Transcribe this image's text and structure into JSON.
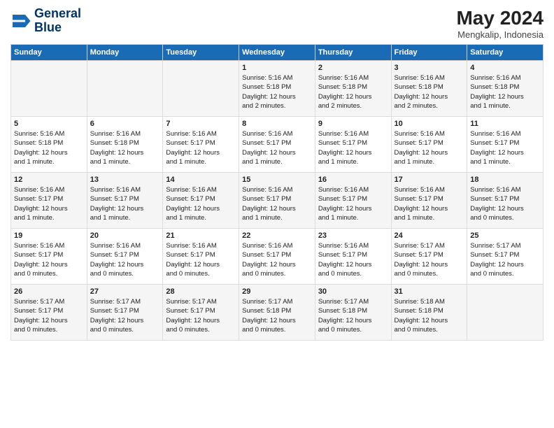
{
  "header": {
    "logo_line1": "General",
    "logo_line2": "Blue",
    "month_year": "May 2024",
    "location": "Mengkalip, Indonesia"
  },
  "weekdays": [
    "Sunday",
    "Monday",
    "Tuesday",
    "Wednesday",
    "Thursday",
    "Friday",
    "Saturday"
  ],
  "weeks": [
    [
      {
        "day": "",
        "detail": ""
      },
      {
        "day": "",
        "detail": ""
      },
      {
        "day": "",
        "detail": ""
      },
      {
        "day": "1",
        "detail": "Sunrise: 5:16 AM\nSunset: 5:18 PM\nDaylight: 12 hours\nand 2 minutes."
      },
      {
        "day": "2",
        "detail": "Sunrise: 5:16 AM\nSunset: 5:18 PM\nDaylight: 12 hours\nand 2 minutes."
      },
      {
        "day": "3",
        "detail": "Sunrise: 5:16 AM\nSunset: 5:18 PM\nDaylight: 12 hours\nand 2 minutes."
      },
      {
        "day": "4",
        "detail": "Sunrise: 5:16 AM\nSunset: 5:18 PM\nDaylight: 12 hours\nand 1 minute."
      }
    ],
    [
      {
        "day": "5",
        "detail": "Sunrise: 5:16 AM\nSunset: 5:18 PM\nDaylight: 12 hours\nand 1 minute."
      },
      {
        "day": "6",
        "detail": "Sunrise: 5:16 AM\nSunset: 5:18 PM\nDaylight: 12 hours\nand 1 minute."
      },
      {
        "day": "7",
        "detail": "Sunrise: 5:16 AM\nSunset: 5:17 PM\nDaylight: 12 hours\nand 1 minute."
      },
      {
        "day": "8",
        "detail": "Sunrise: 5:16 AM\nSunset: 5:17 PM\nDaylight: 12 hours\nand 1 minute."
      },
      {
        "day": "9",
        "detail": "Sunrise: 5:16 AM\nSunset: 5:17 PM\nDaylight: 12 hours\nand 1 minute."
      },
      {
        "day": "10",
        "detail": "Sunrise: 5:16 AM\nSunset: 5:17 PM\nDaylight: 12 hours\nand 1 minute."
      },
      {
        "day": "11",
        "detail": "Sunrise: 5:16 AM\nSunset: 5:17 PM\nDaylight: 12 hours\nand 1 minute."
      }
    ],
    [
      {
        "day": "12",
        "detail": "Sunrise: 5:16 AM\nSunset: 5:17 PM\nDaylight: 12 hours\nand 1 minute."
      },
      {
        "day": "13",
        "detail": "Sunrise: 5:16 AM\nSunset: 5:17 PM\nDaylight: 12 hours\nand 1 minute."
      },
      {
        "day": "14",
        "detail": "Sunrise: 5:16 AM\nSunset: 5:17 PM\nDaylight: 12 hours\nand 1 minute."
      },
      {
        "day": "15",
        "detail": "Sunrise: 5:16 AM\nSunset: 5:17 PM\nDaylight: 12 hours\nand 1 minute."
      },
      {
        "day": "16",
        "detail": "Sunrise: 5:16 AM\nSunset: 5:17 PM\nDaylight: 12 hours\nand 1 minute."
      },
      {
        "day": "17",
        "detail": "Sunrise: 5:16 AM\nSunset: 5:17 PM\nDaylight: 12 hours\nand 1 minute."
      },
      {
        "day": "18",
        "detail": "Sunrise: 5:16 AM\nSunset: 5:17 PM\nDaylight: 12 hours\nand 0 minutes."
      }
    ],
    [
      {
        "day": "19",
        "detail": "Sunrise: 5:16 AM\nSunset: 5:17 PM\nDaylight: 12 hours\nand 0 minutes."
      },
      {
        "day": "20",
        "detail": "Sunrise: 5:16 AM\nSunset: 5:17 PM\nDaylight: 12 hours\nand 0 minutes."
      },
      {
        "day": "21",
        "detail": "Sunrise: 5:16 AM\nSunset: 5:17 PM\nDaylight: 12 hours\nand 0 minutes."
      },
      {
        "day": "22",
        "detail": "Sunrise: 5:16 AM\nSunset: 5:17 PM\nDaylight: 12 hours\nand 0 minutes."
      },
      {
        "day": "23",
        "detail": "Sunrise: 5:16 AM\nSunset: 5:17 PM\nDaylight: 12 hours\nand 0 minutes."
      },
      {
        "day": "24",
        "detail": "Sunrise: 5:17 AM\nSunset: 5:17 PM\nDaylight: 12 hours\nand 0 minutes."
      },
      {
        "day": "25",
        "detail": "Sunrise: 5:17 AM\nSunset: 5:17 PM\nDaylight: 12 hours\nand 0 minutes."
      }
    ],
    [
      {
        "day": "26",
        "detail": "Sunrise: 5:17 AM\nSunset: 5:17 PM\nDaylight: 12 hours\nand 0 minutes."
      },
      {
        "day": "27",
        "detail": "Sunrise: 5:17 AM\nSunset: 5:17 PM\nDaylight: 12 hours\nand 0 minutes."
      },
      {
        "day": "28",
        "detail": "Sunrise: 5:17 AM\nSunset: 5:17 PM\nDaylight: 12 hours\nand 0 minutes."
      },
      {
        "day": "29",
        "detail": "Sunrise: 5:17 AM\nSunset: 5:18 PM\nDaylight: 12 hours\nand 0 minutes."
      },
      {
        "day": "30",
        "detail": "Sunrise: 5:17 AM\nSunset: 5:18 PM\nDaylight: 12 hours\nand 0 minutes."
      },
      {
        "day": "31",
        "detail": "Sunrise: 5:18 AM\nSunset: 5:18 PM\nDaylight: 12 hours\nand 0 minutes."
      },
      {
        "day": "",
        "detail": ""
      }
    ]
  ]
}
